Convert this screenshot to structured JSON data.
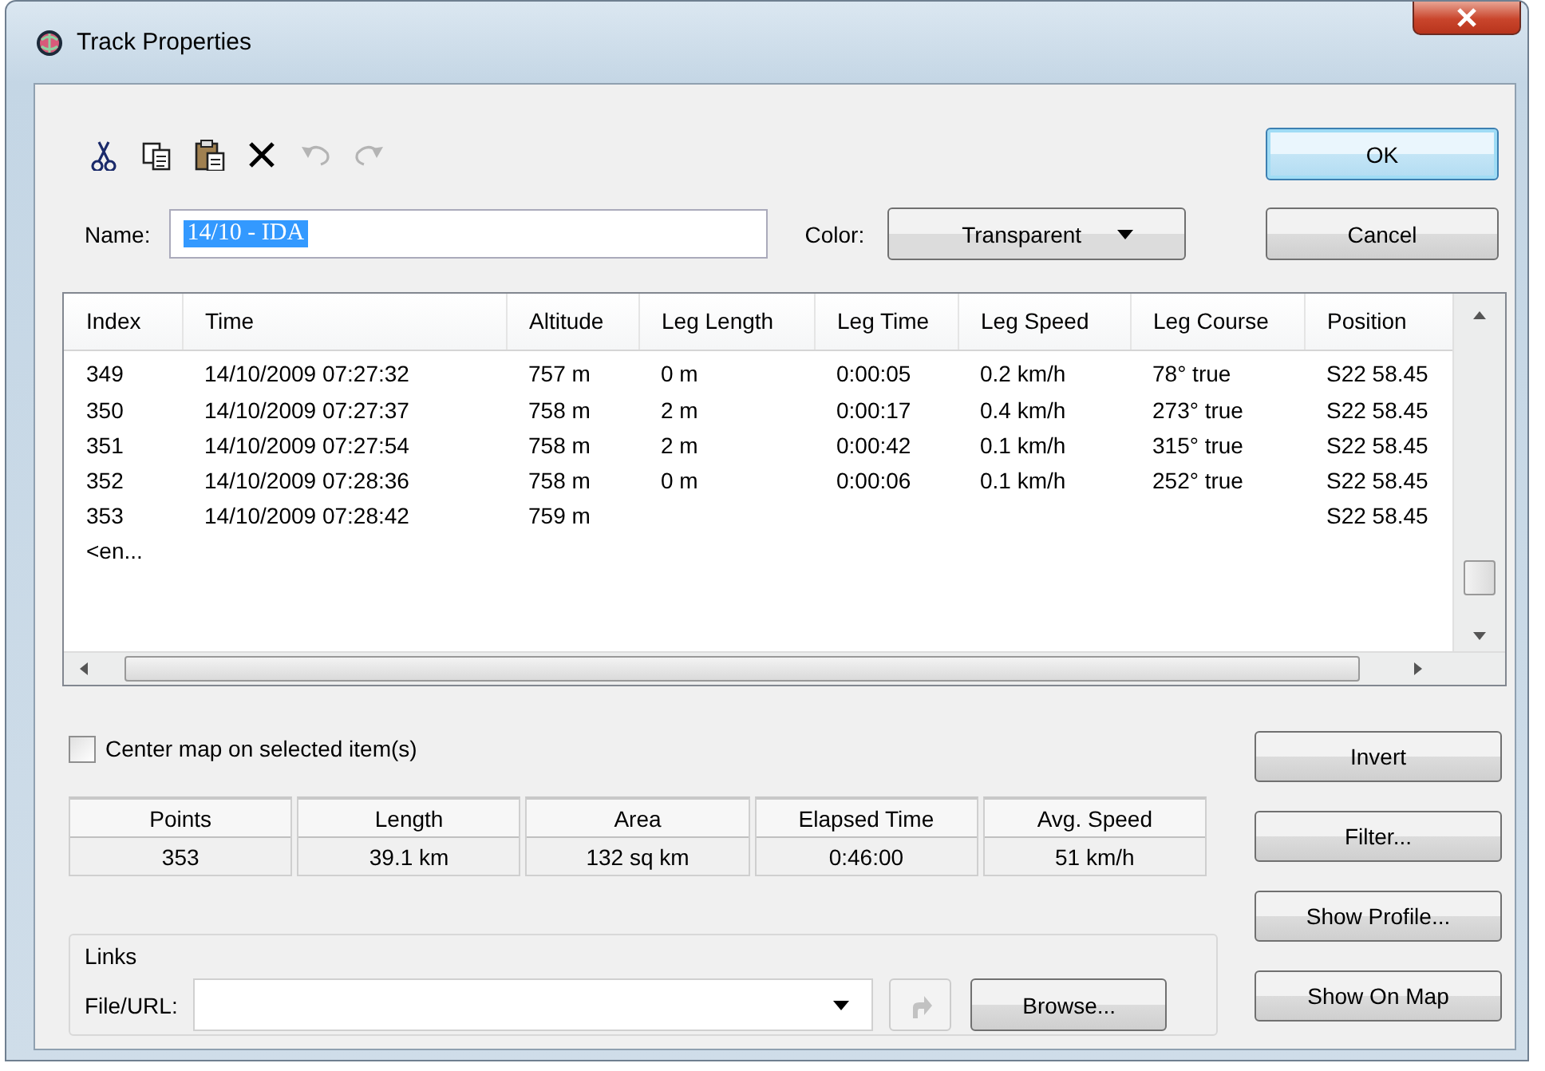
{
  "window": {
    "title": "Track Properties"
  },
  "toolbar": [
    {
      "kind": "cut",
      "disabled": false
    },
    {
      "kind": "copy",
      "disabled": false
    },
    {
      "kind": "paste",
      "disabled": false
    },
    {
      "kind": "delete",
      "disabled": false
    },
    {
      "kind": "undo",
      "disabled": true
    },
    {
      "kind": "redo",
      "disabled": true
    }
  ],
  "name_field": {
    "label": "Name:",
    "value": "14/10 - IDA",
    "selected": true
  },
  "color_field": {
    "label": "Color:",
    "value": "Transparent"
  },
  "dialog_buttons": [
    {
      "label": "OK",
      "default": true
    },
    {
      "label": "Cancel",
      "default": false
    }
  ],
  "table": {
    "columns": [
      "Index",
      "Time",
      "Altitude",
      "Leg Length",
      "Leg Time",
      "Leg Speed",
      "Leg Course",
      "Position"
    ],
    "rows": [
      [
        "349",
        "14/10/2009 07:27:32",
        "757 m",
        "0 m",
        "0:00:05",
        "0.2 km/h",
        "78° true",
        "S22 58.45"
      ],
      [
        "350",
        "14/10/2009 07:27:37",
        "758 m",
        "2 m",
        "0:00:17",
        "0.4 km/h",
        "273° true",
        "S22 58.45"
      ],
      [
        "351",
        "14/10/2009 07:27:54",
        "758 m",
        "2 m",
        "0:00:42",
        "0.1 km/h",
        "315° true",
        "S22 58.45"
      ],
      [
        "352",
        "14/10/2009 07:28:36",
        "758 m",
        "0 m",
        "0:00:06",
        "0.1 km/h",
        "252° true",
        "S22 58.45"
      ],
      [
        "353",
        "14/10/2009 07:28:42",
        "759 m",
        null,
        null,
        null,
        null,
        "S22 58.45"
      ],
      [
        "<en...",
        null,
        null,
        null,
        null,
        null,
        null,
        null
      ]
    ]
  },
  "center_map": {
    "label": "Center map on selected item(s)",
    "checked": false
  },
  "stats": [
    {
      "label": "Points",
      "value": "353"
    },
    {
      "label": "Length",
      "value": "39.1 km"
    },
    {
      "label": "Area",
      "value": "132 sq km"
    },
    {
      "label": "Elapsed Time",
      "value": "0:46:00"
    },
    {
      "label": "Avg. Speed",
      "value": "51 km/h"
    }
  ],
  "links": {
    "title": "Links",
    "label": "File/URL:",
    "browse": "Browse..."
  },
  "side_buttons": [
    "Invert",
    "Filter...",
    "Show Profile...",
    "Show On Map"
  ]
}
